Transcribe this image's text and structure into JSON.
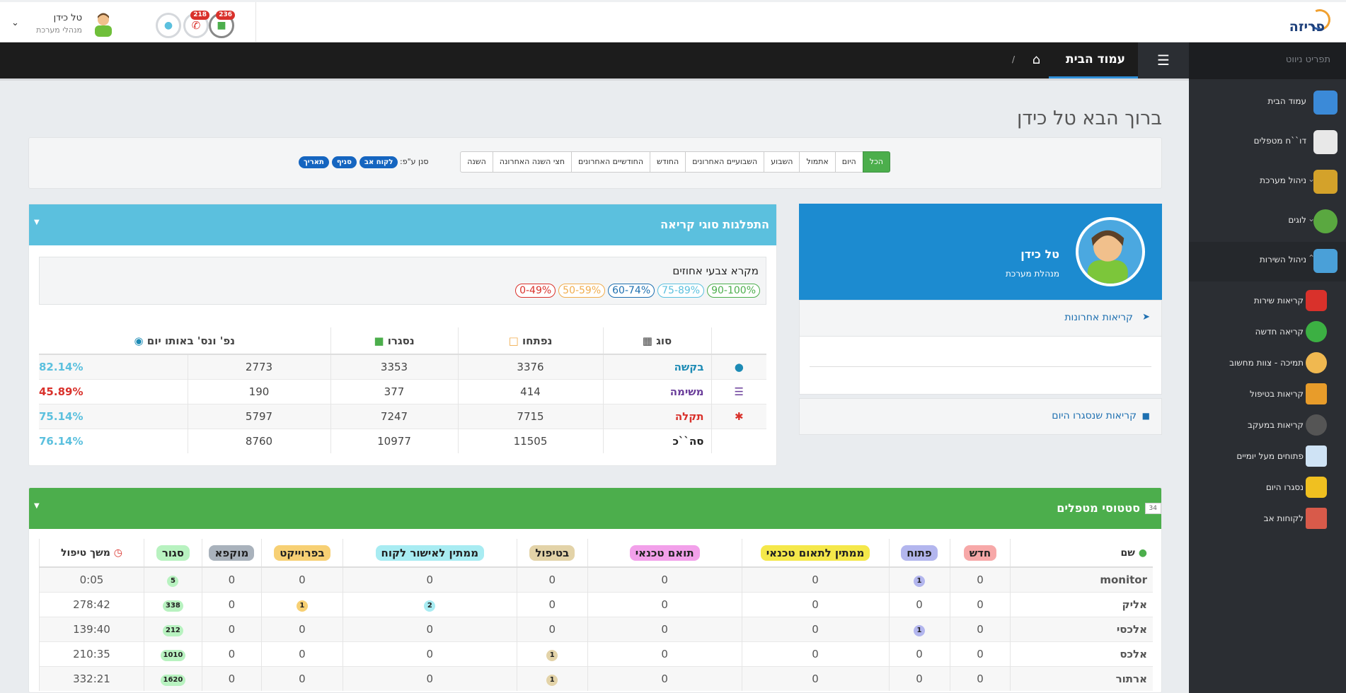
{
  "brand": {
    "logo_text": "פריזה"
  },
  "user": {
    "name": "טל כידן",
    "role": "מנהלי מערכת"
  },
  "notifications": {
    "calls": "218",
    "other": "236"
  },
  "sidebar": {
    "nav_title": "תפריט ניווט",
    "items": [
      {
        "label": "עמוד הבית",
        "icon": "home-icon"
      },
      {
        "label": "דו``ח מטפלים",
        "icon": "doctor-report-icon"
      },
      {
        "label": "ניהול מערכת",
        "icon": "gears-icon"
      },
      {
        "label": "לוגים",
        "icon": "clock-log-icon"
      },
      {
        "label": "ניהול השירות",
        "icon": "chart-icon"
      }
    ],
    "subitems": [
      {
        "label": "קריאות שירות",
        "icon": "phone-icon"
      },
      {
        "label": "קריאה חדשה",
        "icon": "new-call-icon"
      },
      {
        "label": "תמיכה - צוות מחשוב",
        "icon": "support-icon"
      },
      {
        "label": "קריאות בטיפול",
        "icon": "box-icon"
      },
      {
        "label": "קריאות במעקב",
        "icon": "spy-icon"
      },
      {
        "label": "פתוחים מעל יומיים",
        "icon": "timer-icon"
      },
      {
        "label": "נסגרו היום",
        "icon": "lock-icon"
      },
      {
        "label": "לקוחות אב",
        "icon": "building-icon"
      }
    ]
  },
  "breadcrumb": {
    "current": "עמוד הבית",
    "separator": "/"
  },
  "welcome": "ברוך הבא טל כידן",
  "filters": {
    "buttons": [
      "הכל",
      "היום",
      "אתמול",
      "השבוע",
      "השבועיים האחרונים",
      "החודש",
      "החודשיים האחרונים",
      "חצי השנה האחרונה",
      "השנה"
    ],
    "sort_label": "סנן ע\"פ:",
    "sort_pills": [
      "לקוח אב",
      "סניף",
      "תאריך"
    ]
  },
  "profile": {
    "name": "טל כידן",
    "role": "מנהלת מערכת"
  },
  "recent_calls": "קריאות אחרונות",
  "closed_today": "קריאות שנסגרו היום",
  "types_panel": {
    "title": "התפלגות סוגי קריאה",
    "legend_title": "מקרא צבעי אחוזים",
    "legend": [
      {
        "label": "90-100%",
        "color": "#4cae4c"
      },
      {
        "label": "75-89%",
        "color": "#5bc0de"
      },
      {
        "label": "60-74%",
        "color": "#1d6fb0"
      },
      {
        "label": "50-59%",
        "color": "#f0ad4e"
      },
      {
        "label": "0-49%",
        "color": "#d9312b"
      }
    ],
    "headers": {
      "type": "סוג",
      "opened": "נפתחו",
      "closed": "נסגרו",
      "same_day": "נפ' ונס' באותו יום"
    },
    "rows": [
      {
        "type": "בקשה",
        "color": "#1d8bb5",
        "opened": "3376",
        "closed": "3353",
        "same_day": "2773",
        "pct": "82.14%",
        "pct_color": "#5bc0de",
        "icon": "chat-icon"
      },
      {
        "type": "משימה",
        "color": "#6a3d9a",
        "opened": "414",
        "closed": "377",
        "same_day": "190",
        "pct": "45.89%",
        "pct_color": "#d9312b",
        "icon": "tasks-icon"
      },
      {
        "type": "תקלה",
        "color": "#d9312b",
        "opened": "7715",
        "closed": "7247",
        "same_day": "5797",
        "pct": "75.14%",
        "pct_color": "#5bc0de",
        "icon": "bug-icon"
      },
      {
        "type": "סה``כ",
        "color": "#222",
        "opened": "11505",
        "closed": "10977",
        "same_day": "8760",
        "pct": "76.14%",
        "pct_color": "#5bc0de",
        "icon": ""
      }
    ]
  },
  "status_panel": {
    "title": "סטטוסי מטפלים",
    "count": "34",
    "headers": [
      {
        "label": "שם",
        "bg": "transparent"
      },
      {
        "label": "חדש",
        "bg": "#f7a8a8"
      },
      {
        "label": "פתוח",
        "bg": "#b3b6ee"
      },
      {
        "label": "ממתין לתאום טכנאי",
        "bg": "#f5e84a"
      },
      {
        "label": "תואם טכנאי",
        "bg": "#f2a0ea"
      },
      {
        "label": "בטיפול",
        "bg": "#e3d3a8"
      },
      {
        "label": "ממתין לאישור לקוח",
        "bg": "#a8ecf2"
      },
      {
        "label": "בפרוייקט",
        "bg": "#f7d074"
      },
      {
        "label": "מוקפא",
        "bg": "#a9b2bc"
      },
      {
        "label": "סגור",
        "bg": "#b8f2c0"
      },
      {
        "label": "משך טיפול",
        "bg": "transparent"
      }
    ],
    "rows": [
      {
        "name": "monitor",
        "cells": [
          "0",
          "1",
          "0",
          "0",
          "0",
          "0",
          "0",
          "0",
          "5"
        ],
        "duration": "0:05"
      },
      {
        "name": "אליק",
        "cells": [
          "0",
          "0",
          "0",
          "0",
          "0",
          "2",
          "1",
          "0",
          "338"
        ],
        "duration": "278:42"
      },
      {
        "name": "אלכסי",
        "cells": [
          "0",
          "1",
          "0",
          "0",
          "0",
          "0",
          "0",
          "0",
          "212"
        ],
        "duration": "139:40"
      },
      {
        "name": "אלכס",
        "cells": [
          "0",
          "0",
          "0",
          "0",
          "1",
          "0",
          "0",
          "0",
          "1010"
        ],
        "duration": "210:35"
      },
      {
        "name": "ארתור",
        "cells": [
          "0",
          "0",
          "0",
          "0",
          "1",
          "0",
          "0",
          "0",
          "1620"
        ],
        "duration": "332:21"
      }
    ]
  }
}
